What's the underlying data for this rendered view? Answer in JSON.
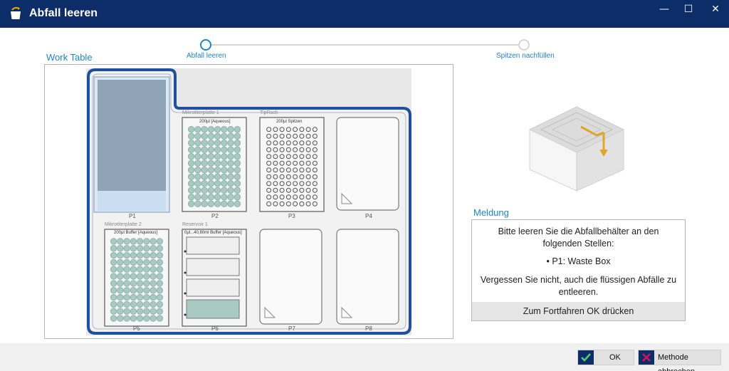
{
  "window": {
    "title": "Abfall leeren",
    "controls": {
      "minimize": "—",
      "maximize": "☐",
      "close": "✕"
    }
  },
  "stepper": {
    "steps": [
      {
        "label": "Abfall leeren",
        "state": "active"
      },
      {
        "label": "Spitzen nachfüllen",
        "state": "inactive"
      }
    ]
  },
  "worktable": {
    "title": "Work Table",
    "positions": [
      {
        "id": "P1",
        "label": "P1",
        "content": "waste-box",
        "plate_title": ""
      },
      {
        "id": "P2",
        "label": "P2",
        "content": "microplate",
        "plate_title": "Mikrotiterplatte 1",
        "plate_caption": "200µl [Aqueous]"
      },
      {
        "id": "P3",
        "label": "P3",
        "content": "tip-rack",
        "plate_title": "TipRack",
        "plate_caption": "200µl Spitzen"
      },
      {
        "id": "P4",
        "label": "P4",
        "content": "empty",
        "plate_title": ""
      },
      {
        "id": "P5",
        "label": "P5",
        "content": "microplate",
        "plate_title": "Mikrotiterplatte 2",
        "plate_caption": "200µl Buffer [Aqueous]"
      },
      {
        "id": "P6",
        "label": "P6",
        "content": "reservoir",
        "plate_title": "Reservoir 1",
        "plate_caption": "0µl...40,80ml Buffer [Aqueous]"
      },
      {
        "id": "P7",
        "label": "P7",
        "content": "empty",
        "plate_title": ""
      },
      {
        "id": "P8",
        "label": "P8",
        "content": "empty",
        "plate_title": ""
      }
    ]
  },
  "message": {
    "title": "Meldung",
    "line1": "Bitte leeren Sie die Abfallbehälter an den",
    "line2": "folgenden Stellen:",
    "bullet": "• P1: Waste Box",
    "line3": "Vergessen Sie nicht, auch die flüssigen Abfälle zu",
    "line4": "entleeren.",
    "footer": "Zum Fortfahren OK drücken"
  },
  "buttons": {
    "ok": "OK",
    "cancel": "Methode abbrechen"
  },
  "colors": {
    "titlebar": "#0d2d68",
    "accent": "#1c86c8",
    "deck_outline": "#1f4f9e",
    "well": "#a9c9c3",
    "waste": "#8fa4b6"
  }
}
